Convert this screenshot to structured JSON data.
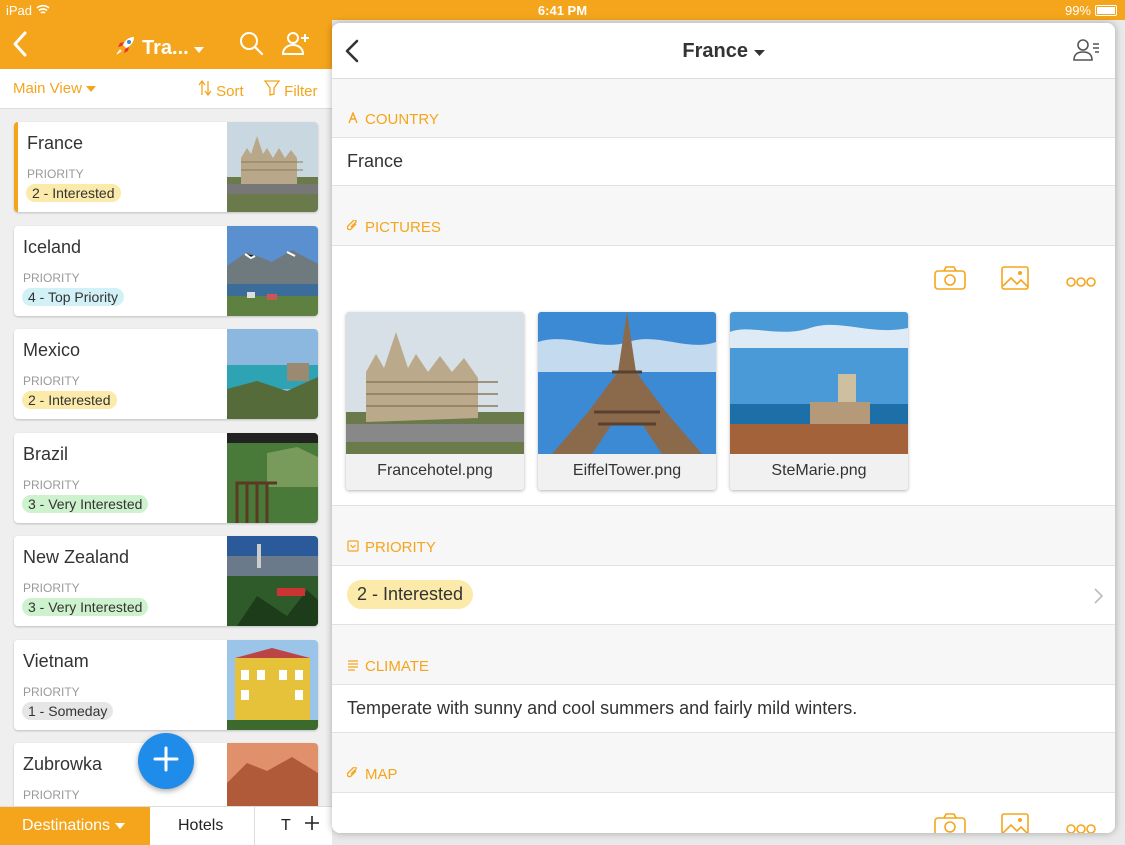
{
  "status": {
    "device": "iPad",
    "time": "6:41 PM",
    "battery": "99%"
  },
  "nav": {
    "title": "Tra...",
    "icons": [
      "back-chevron-icon",
      "rocket-icon",
      "search-icon",
      "add-user-icon"
    ]
  },
  "toolbar": {
    "main_view": "Main View",
    "sort": "Sort",
    "filter": "Filter"
  },
  "colors": {
    "accent": "#f5a51c",
    "fab": "#1f8cea",
    "interested": "#fbeaa9",
    "top_priority": "#d2f1f7",
    "very_interested": "#cdf2cd",
    "someday": "#e6e6e6"
  },
  "list": [
    {
      "name": "France",
      "priority_label": "PRIORITY",
      "priority": "2 - Interested",
      "color": "#fbeaa9"
    },
    {
      "name": "Iceland",
      "priority_label": "PRIORITY",
      "priority": "4 - Top Priority",
      "color": "#d2f1f7"
    },
    {
      "name": "Mexico",
      "priority_label": "PRIORITY",
      "priority": "2 - Interested",
      "color": "#fbeaa9"
    },
    {
      "name": "Brazil",
      "priority_label": "PRIORITY",
      "priority": "3 - Very Interested",
      "color": "#cdf2cd"
    },
    {
      "name": "New Zealand",
      "priority_label": "PRIORITY",
      "priority": "3 - Very Interested",
      "color": "#cdf2cd"
    },
    {
      "name": "Vietnam",
      "priority_label": "PRIORITY",
      "priority": "1 - Someday",
      "color": "#e6e6e6"
    },
    {
      "name": "Zubrowka",
      "priority_label": "PRIORITY",
      "priority": "",
      "color": ""
    }
  ],
  "tabs": {
    "destinations": "Destinations",
    "hotels": "Hotels",
    "third": "T"
  },
  "detail": {
    "title": "France",
    "country_label": "COUNTRY",
    "country_value": "France",
    "pictures_label": "PICTURES",
    "pictures": [
      "Francehotel.png",
      "EiffelTower.png",
      "SteMarie.png"
    ],
    "priority_label": "PRIORITY",
    "priority_value": "2 - Interested",
    "climate_label": "CLIMATE",
    "climate_value": "Temperate with sunny and cool summers and fairly mild winters.",
    "map_label": "MAP"
  }
}
